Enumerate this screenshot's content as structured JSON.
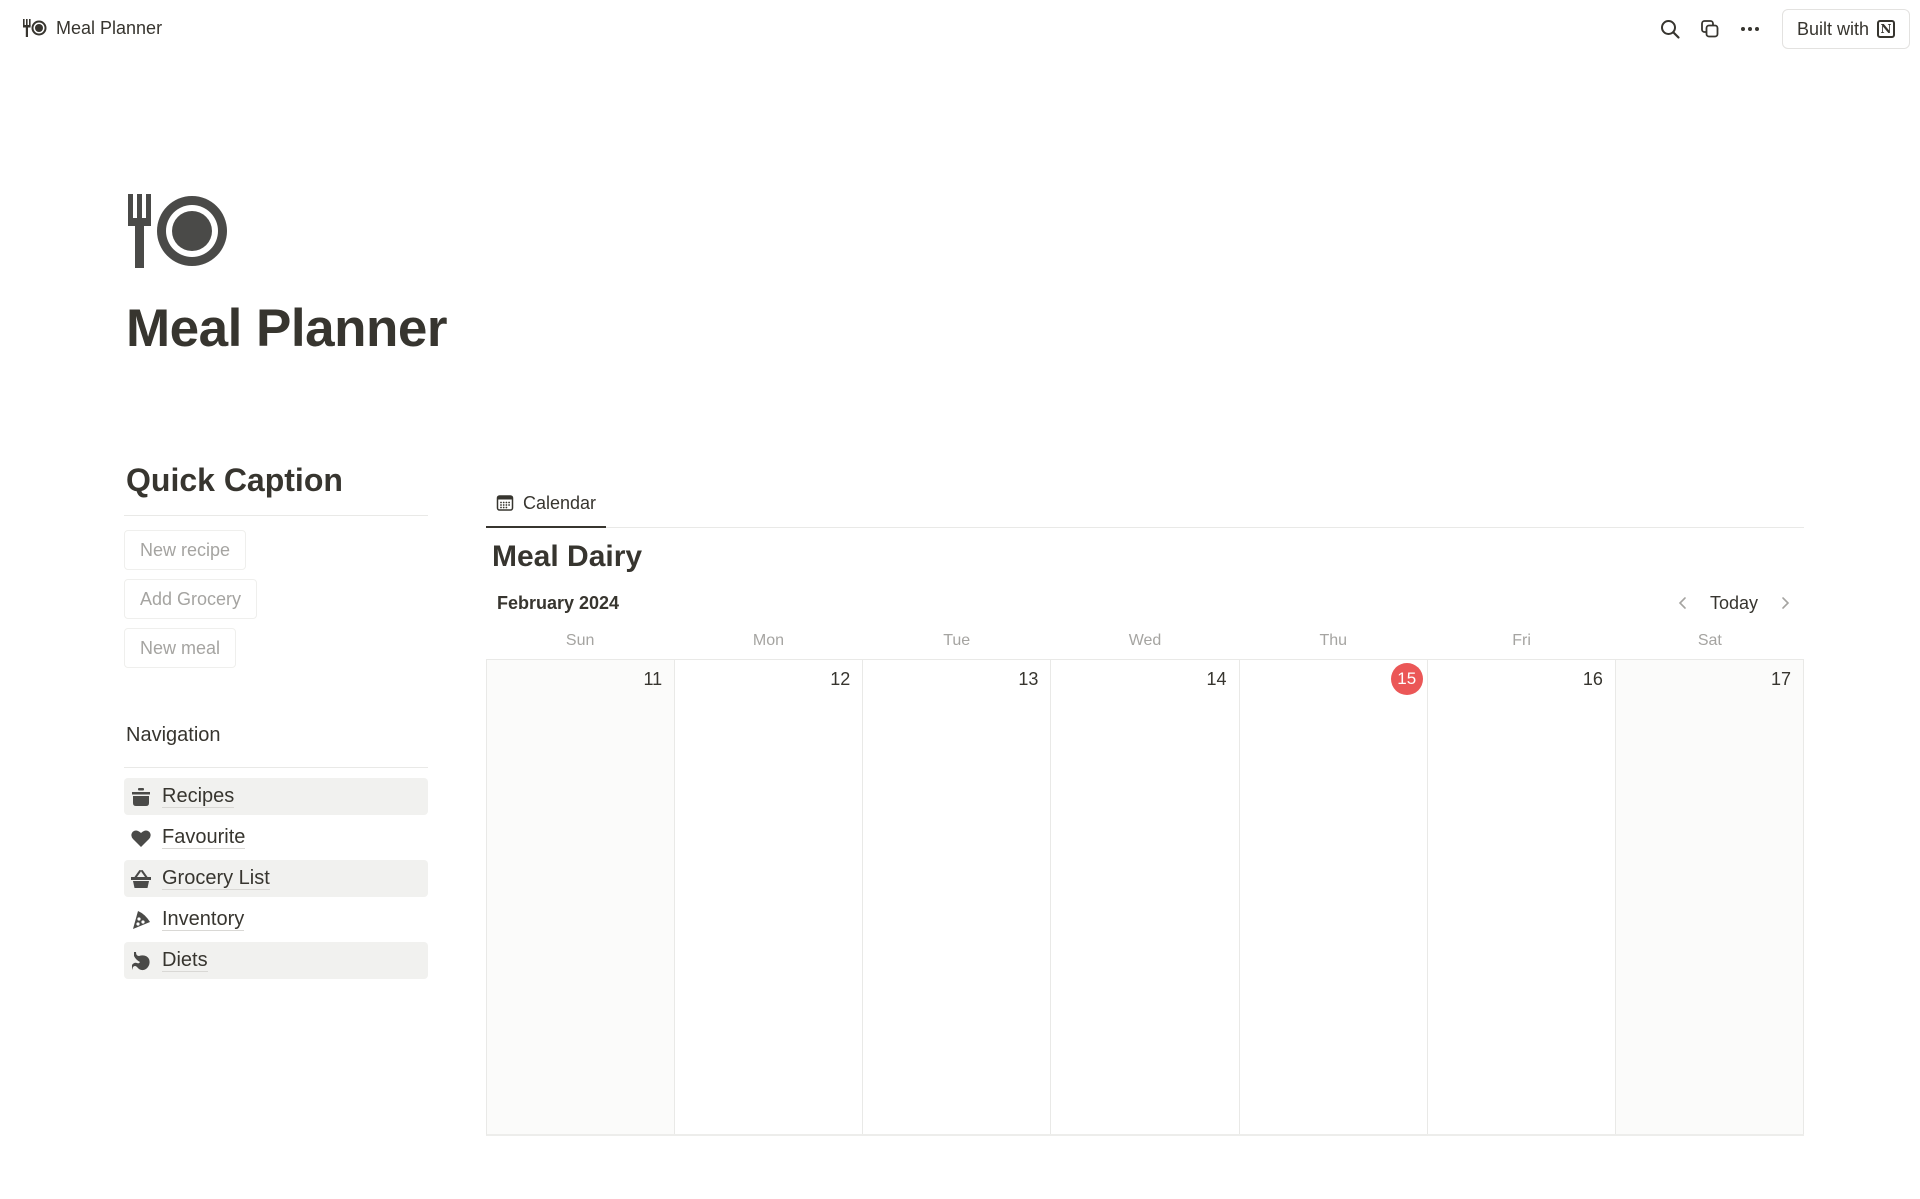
{
  "topbar": {
    "breadcrumb_title": "Meal Planner",
    "breadcrumb_icon": "fork-and-plate-icon",
    "actions": [
      "search-icon",
      "duplicate-icon",
      "more-icon"
    ],
    "built_with_label": "Built with",
    "built_with_logo": "N"
  },
  "page": {
    "icon": "fork-and-plate-icon",
    "title": "Meal Planner"
  },
  "quick_caption": {
    "heading": "Quick Caption",
    "buttons": [
      "New recipe",
      "Add Grocery",
      "New meal"
    ]
  },
  "navigation": {
    "heading": "Navigation",
    "items": [
      {
        "label": "Recipes",
        "icon": "cooking-pot-icon"
      },
      {
        "label": "Favourite",
        "icon": "heart-icon"
      },
      {
        "label": "Grocery List",
        "icon": "basket-icon"
      },
      {
        "label": "Inventory",
        "icon": "pizza-slice-icon"
      },
      {
        "label": "Diets",
        "icon": "stomach-icon"
      }
    ]
  },
  "calendar": {
    "tab_label": "Calendar",
    "view_title": "Meal Dairy",
    "month_label": "February 2024",
    "today_label": "Today",
    "weekdays": [
      "Sun",
      "Mon",
      "Tue",
      "Wed",
      "Thu",
      "Fri",
      "Sat"
    ],
    "days": [
      "11",
      "12",
      "13",
      "14",
      "15",
      "16",
      "17"
    ],
    "today": "15",
    "today_color": "#eb5757"
  }
}
